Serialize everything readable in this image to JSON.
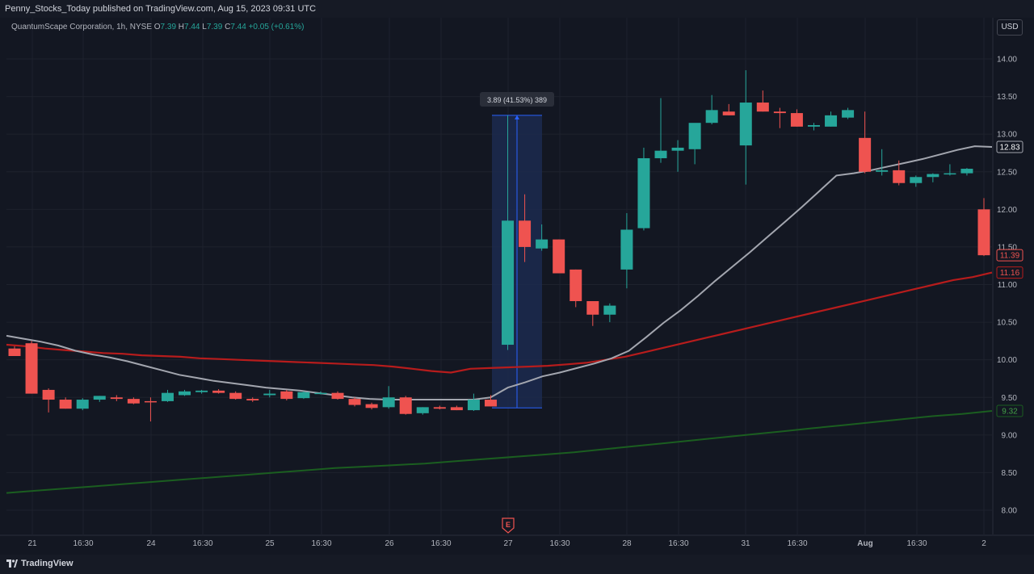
{
  "header": {
    "published": "Penny_Stocks_Today published on TradingView.com, Aug 15, 2023 09:31 UTC"
  },
  "legend": {
    "symbol": "QuantumScape Corporation, 1h, NYSE",
    "o_label": "O",
    "o_val": "7.39",
    "h_label": "H",
    "h_val": "7.44",
    "l_label": "L",
    "l_val": "7.39",
    "c_label": "C",
    "c_val": "7.44",
    "change": "+0.05 (+0.61%)"
  },
  "currency_button": "USD",
  "footer": {
    "brand": "TradingView"
  },
  "earnings_marker": "E",
  "measure": {
    "label": "3.89 (41.53%) 389"
  },
  "colors": {
    "up": "#26a69a",
    "down": "#ef5350",
    "ma_gray": "#a3a6af",
    "ma_red": "#b71c1c",
    "ma_green": "#1b5e20",
    "measure_fill": "#1c2a4f",
    "measure_line": "#2962ff"
  },
  "price_axis": {
    "ticks": [
      "14.00",
      "13.50",
      "13.00",
      "12.50",
      "12.00",
      "11.50",
      "11.00",
      "10.50",
      "10.00",
      "9.50",
      "9.00",
      "8.50",
      "8.00"
    ],
    "badges": [
      {
        "value": "12.83",
        "color": "#a3a6af",
        "text_color": "#ffffff"
      },
      {
        "value": "11.39",
        "color": "#ef5350",
        "text_color": "#ef5350"
      },
      {
        "value": "11.16",
        "color": "#b71c1c",
        "text_color": "#ef5350"
      },
      {
        "value": "9.32",
        "color": "#1b5e20",
        "text_color": "#43a047"
      }
    ]
  },
  "time_axis": {
    "labels": [
      "21",
      "16:30",
      "24",
      "16:30",
      "25",
      "16:30",
      "26",
      "16:30",
      "27",
      "16:30",
      "28",
      "16:30",
      "31",
      "16:30",
      "Aug",
      "16:30",
      "2"
    ]
  },
  "chart_data": {
    "type": "candlestick",
    "ylim": [
      7.8,
      14.2
    ],
    "candles": [
      {
        "o": 10.15,
        "h": 10.18,
        "l": 10.05,
        "c": 10.05
      },
      {
        "o": 10.22,
        "h": 10.25,
        "l": 9.55,
        "c": 9.55
      },
      {
        "o": 9.6,
        "h": 9.62,
        "l": 9.3,
        "c": 9.47
      },
      {
        "o": 9.47,
        "h": 9.5,
        "l": 9.35,
        "c": 9.35
      },
      {
        "o": 9.35,
        "h": 9.49,
        "l": 9.33,
        "c": 9.47
      },
      {
        "o": 9.47,
        "h": 9.52,
        "l": 9.44,
        "c": 9.52
      },
      {
        "o": 9.5,
        "h": 9.53,
        "l": 9.45,
        "c": 9.48
      },
      {
        "o": 9.48,
        "h": 9.5,
        "l": 9.41,
        "c": 9.42
      },
      {
        "o": 9.45,
        "h": 9.5,
        "l": 9.18,
        "c": 9.44
      },
      {
        "o": 9.45,
        "h": 9.6,
        "l": 9.44,
        "c": 9.56
      },
      {
        "o": 9.53,
        "h": 9.6,
        "l": 9.52,
        "c": 9.58
      },
      {
        "o": 9.57,
        "h": 9.6,
        "l": 9.55,
        "c": 9.59
      },
      {
        "o": 9.59,
        "h": 9.61,
        "l": 9.55,
        "c": 9.56
      },
      {
        "o": 9.56,
        "h": 9.58,
        "l": 9.47,
        "c": 9.48
      },
      {
        "o": 9.48,
        "h": 9.5,
        "l": 9.44,
        "c": 9.46
      },
      {
        "o": 9.53,
        "h": 9.6,
        "l": 9.5,
        "c": 9.55
      },
      {
        "o": 9.58,
        "h": 9.6,
        "l": 9.46,
        "c": 9.48
      },
      {
        "o": 9.49,
        "h": 9.58,
        "l": 9.48,
        "c": 9.57
      },
      {
        "o": 9.55,
        "h": 9.58,
        "l": 9.54,
        "c": 9.56
      },
      {
        "o": 9.56,
        "h": 9.58,
        "l": 9.47,
        "c": 9.48
      },
      {
        "o": 9.48,
        "h": 9.5,
        "l": 9.38,
        "c": 9.4
      },
      {
        "o": 9.41,
        "h": 9.43,
        "l": 9.34,
        "c": 9.36
      },
      {
        "o": 9.37,
        "h": 9.65,
        "l": 9.35,
        "c": 9.5
      },
      {
        "o": 9.5,
        "h": 9.52,
        "l": 9.27,
        "c": 9.28
      },
      {
        "o": 9.29,
        "h": 9.37,
        "l": 9.27,
        "c": 9.37
      },
      {
        "o": 9.37,
        "h": 9.39,
        "l": 9.34,
        "c": 9.35
      },
      {
        "o": 9.37,
        "h": 9.39,
        "l": 9.33,
        "c": 9.33
      },
      {
        "o": 9.33,
        "h": 9.55,
        "l": 9.32,
        "c": 9.47
      },
      {
        "o": 9.47,
        "h": 9.53,
        "l": 9.38,
        "c": 9.38
      },
      {
        "o": 10.2,
        "h": 13.25,
        "l": 10.13,
        "c": 11.85
      },
      {
        "o": 11.85,
        "h": 12.2,
        "l": 11.3,
        "c": 11.5
      },
      {
        "o": 11.48,
        "h": 11.8,
        "l": 11.45,
        "c": 11.6
      },
      {
        "o": 11.6,
        "h": 11.6,
        "l": 11.15,
        "c": 11.15
      },
      {
        "o": 11.2,
        "h": 11.2,
        "l": 10.7,
        "c": 10.78
      },
      {
        "o": 10.78,
        "h": 10.78,
        "l": 10.45,
        "c": 10.6
      },
      {
        "o": 10.6,
        "h": 10.75,
        "l": 10.5,
        "c": 10.72
      },
      {
        "o": 11.2,
        "h": 11.95,
        "l": 10.95,
        "c": 11.73
      },
      {
        "o": 11.75,
        "h": 12.82,
        "l": 11.72,
        "c": 12.68
      },
      {
        "o": 12.68,
        "h": 13.48,
        "l": 12.62,
        "c": 12.78
      },
      {
        "o": 12.78,
        "h": 12.92,
        "l": 12.5,
        "c": 12.82
      },
      {
        "o": 12.8,
        "h": 13.12,
        "l": 12.6,
        "c": 13.15
      },
      {
        "o": 13.15,
        "h": 13.52,
        "l": 13.13,
        "c": 13.32
      },
      {
        "o": 13.3,
        "h": 13.4,
        "l": 13.25,
        "c": 13.25
      },
      {
        "o": 12.85,
        "h": 13.85,
        "l": 12.33,
        "c": 13.42
      },
      {
        "o": 13.42,
        "h": 13.58,
        "l": 13.3,
        "c": 13.3
      },
      {
        "o": 13.3,
        "h": 13.35,
        "l": 13.08,
        "c": 13.28
      },
      {
        "o": 13.28,
        "h": 13.33,
        "l": 13.1,
        "c": 13.1
      },
      {
        "o": 13.1,
        "h": 13.15,
        "l": 13.05,
        "c": 13.12
      },
      {
        "o": 13.1,
        "h": 13.3,
        "l": 13.1,
        "c": 13.25
      },
      {
        "o": 13.22,
        "h": 13.35,
        "l": 13.2,
        "c": 13.32
      },
      {
        "o": 12.95,
        "h": 13.3,
        "l": 12.48,
        "c": 12.5
      },
      {
        "o": 12.5,
        "h": 12.8,
        "l": 12.45,
        "c": 12.52
      },
      {
        "o": 12.52,
        "h": 12.65,
        "l": 12.32,
        "c": 12.35
      },
      {
        "o": 12.35,
        "h": 12.45,
        "l": 12.3,
        "c": 12.43
      },
      {
        "o": 12.43,
        "h": 12.48,
        "l": 12.36,
        "c": 12.47
      },
      {
        "o": 12.47,
        "h": 12.6,
        "l": 12.45,
        "c": 12.48
      },
      {
        "o": 12.48,
        "h": 12.55,
        "l": 12.45,
        "c": 12.54
      },
      {
        "o": 12.0,
        "h": 12.15,
        "l": 11.38,
        "c": 11.39
      }
    ],
    "ma_gray": [
      10.32,
      10.28,
      10.24,
      10.19,
      10.12,
      10.07,
      10.03,
      9.98,
      9.92,
      9.86,
      9.8,
      9.76,
      9.72,
      9.69,
      9.66,
      9.63,
      9.61,
      9.59,
      9.56,
      9.53,
      9.5,
      9.48,
      9.47,
      9.47,
      9.47,
      9.47,
      9.47,
      9.47,
      9.5,
      9.63,
      9.7,
      9.78,
      9.83,
      9.89,
      9.95,
      10.02,
      10.12,
      10.3,
      10.49,
      10.66,
      10.85,
      11.05,
      11.24,
      11.43,
      11.63,
      11.83,
      12.03,
      12.24,
      12.45,
      12.48,
      12.52,
      12.57,
      12.62,
      12.67,
      12.73,
      12.79,
      12.84,
      12.83
    ],
    "ma_red": [
      10.2,
      10.18,
      10.15,
      10.13,
      10.11,
      10.09,
      10.08,
      10.06,
      10.05,
      10.04,
      10.02,
      10.01,
      10.0,
      9.99,
      9.98,
      9.97,
      9.96,
      9.95,
      9.94,
      9.93,
      9.91,
      9.88,
      9.85,
      9.83,
      9.88,
      9.89,
      9.9,
      9.91,
      9.92,
      9.94,
      9.96,
      10.0,
      10.04,
      10.1,
      10.16,
      10.22,
      10.28,
      10.34,
      10.4,
      10.46,
      10.52,
      10.58,
      10.64,
      10.7,
      10.76,
      10.82,
      10.88,
      10.94,
      11.0,
      11.06,
      11.1,
      11.16
    ],
    "ma_green": [
      8.23,
      8.26,
      8.29,
      8.32,
      8.35,
      8.38,
      8.41,
      8.44,
      8.47,
      8.5,
      8.53,
      8.56,
      8.58,
      8.6,
      8.62,
      8.65,
      8.68,
      8.71,
      8.74,
      8.77,
      8.81,
      8.85,
      8.89,
      8.93,
      8.97,
      9.01,
      9.05,
      9.09,
      9.13,
      9.17,
      9.21,
      9.25,
      9.28,
      9.32
    ],
    "measure": {
      "from": 9.36,
      "to": 13.25,
      "change": 3.89,
      "percent": 41.53,
      "bars": 389
    }
  }
}
